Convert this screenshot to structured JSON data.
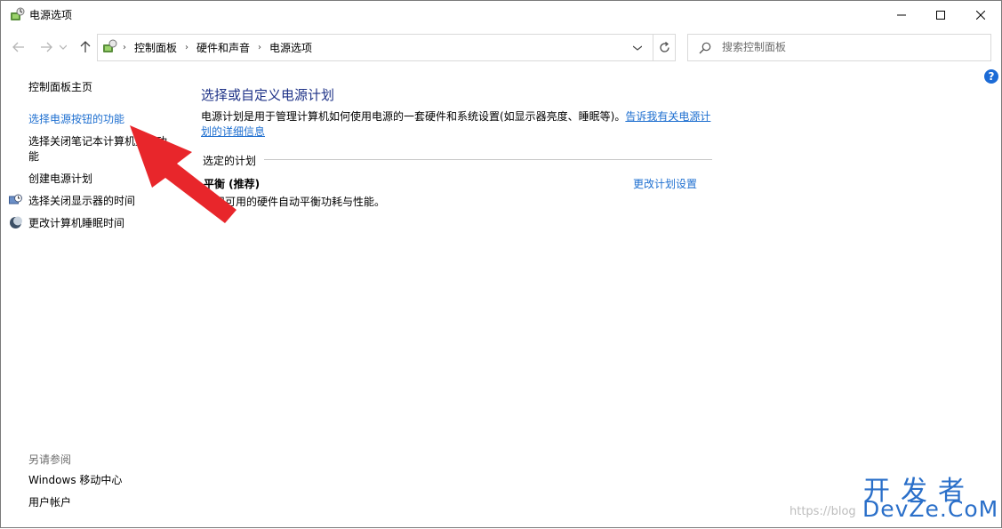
{
  "window": {
    "title": "电源选项"
  },
  "address": {
    "crumbs": [
      "控制面板",
      "硬件和声音",
      "电源选项"
    ]
  },
  "search": {
    "placeholder": "搜索控制面板"
  },
  "help": {
    "label": "?"
  },
  "sidebar": {
    "home": "控制面板主页",
    "items": [
      {
        "label": "选择电源按钮的功能",
        "style": "link"
      },
      {
        "label": "选择关闭笔记本计算机盖的功",
        "label2": "能"
      },
      {
        "label": "创建电源计划"
      },
      {
        "label": "选择关闭显示器的时间",
        "icon": "monitor-clock-icon"
      },
      {
        "label": "更改计算机睡眠时间",
        "icon": "moon-icon"
      }
    ],
    "see_also_title": "另请参阅",
    "see_also": [
      "Windows 移动中心",
      "用户帐户"
    ]
  },
  "main": {
    "heading": "选择或自定义电源计划",
    "description": "电源计划是用于管理计算机如何使用电源的一套硬件和系统设置(如显示器亮度、睡眠等)。",
    "description_link": "告诉我有关电源计划的详细信息",
    "section_label": "选定的计划",
    "plan": {
      "name": "平衡 (推荐)",
      "description": "利用可用的硬件自动平衡功耗与性能。",
      "change_link": "更改计划设置"
    }
  },
  "watermark": {
    "url": "https://blog",
    "cn": "开发者",
    "en": "DevZe.CoM"
  },
  "colors": {
    "accent": "#1e6fd0",
    "heading": "#1e3287",
    "annotation_arrow": "#e8262b",
    "watermark": "#2a6fc9"
  }
}
